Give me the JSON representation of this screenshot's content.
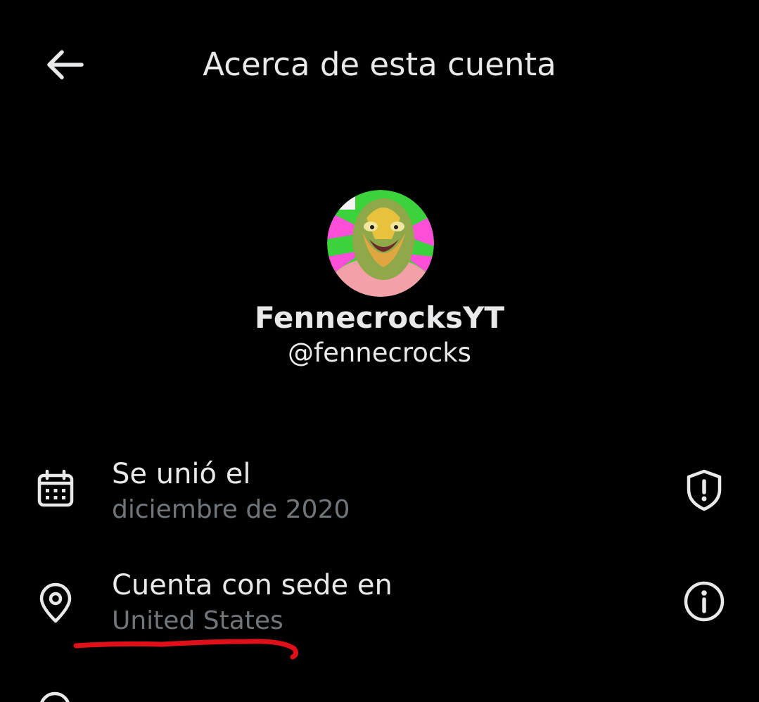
{
  "header": {
    "title": "Acerca de esta cuenta",
    "back_icon": "arrow-left-icon"
  },
  "profile": {
    "display_name": "FennecrocksYT",
    "handle": "@fennecrocks"
  },
  "details": [
    {
      "icon": "calendar-icon",
      "label": "Se unió el",
      "value": "diciembre de 2020",
      "action_icon": "shield-alert-icon"
    },
    {
      "icon": "location-pin-icon",
      "label": "Cuenta con sede en",
      "value": "United States",
      "action_icon": "info-icon"
    }
  ],
  "colors": {
    "background": "#000000",
    "primary_text": "#e7e9ea",
    "secondary_text": "#71767b",
    "annotation": "#e0101a"
  }
}
